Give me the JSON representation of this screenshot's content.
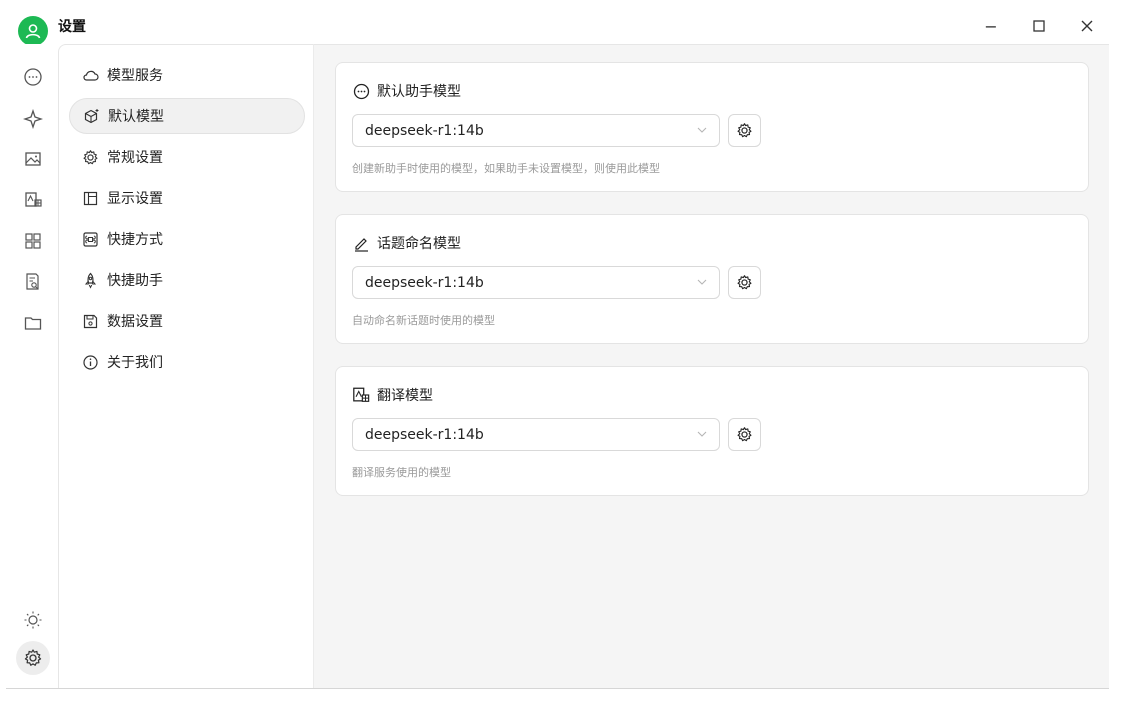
{
  "window": {
    "title": "设置",
    "controls": {
      "minimize": "−",
      "maximize": "☐",
      "close": "✕"
    }
  },
  "rail": {
    "icons": [
      "avatar-icon",
      "chat-icon",
      "sparkle-icon",
      "image-icon",
      "translate-icon",
      "apps-icon",
      "document-search-icon",
      "folder-icon",
      "theme-sun-icon",
      "settings-gear-icon"
    ]
  },
  "menu": {
    "items": [
      {
        "label": "模型服务",
        "icon": "cloud-icon"
      },
      {
        "label": "默认模型",
        "icon": "model-cube-icon"
      },
      {
        "label": "常规设置",
        "icon": "gear-icon"
      },
      {
        "label": "显示设置",
        "icon": "layout-icon"
      },
      {
        "label": "快捷方式",
        "icon": "command-key-icon"
      },
      {
        "label": "快捷助手",
        "icon": "rocket-icon"
      },
      {
        "label": "数据设置",
        "icon": "save-disk-icon"
      },
      {
        "label": "关于我们",
        "icon": "info-icon"
      }
    ],
    "active_index": 1
  },
  "main": {
    "cards": [
      {
        "title": "默认助手模型",
        "icon": "chat-bubble-icon",
        "select_value": "deepseek-r1:14b",
        "description": "创建新助手时使用的模型，如果助手未设置模型，则使用此模型"
      },
      {
        "title": "话题命名模型",
        "icon": "pen-icon",
        "select_value": "deepseek-r1:14b",
        "description": "自动命名新话题时使用的模型"
      },
      {
        "title": "翻译模型",
        "icon": "translate-icon",
        "select_value": "deepseek-r1:14b",
        "description": "翻译服务使用的模型"
      }
    ]
  },
  "colors": {
    "accent": "#1db954",
    "main_bg": "#f5f5f5",
    "description_text": "#9a9a9a"
  }
}
